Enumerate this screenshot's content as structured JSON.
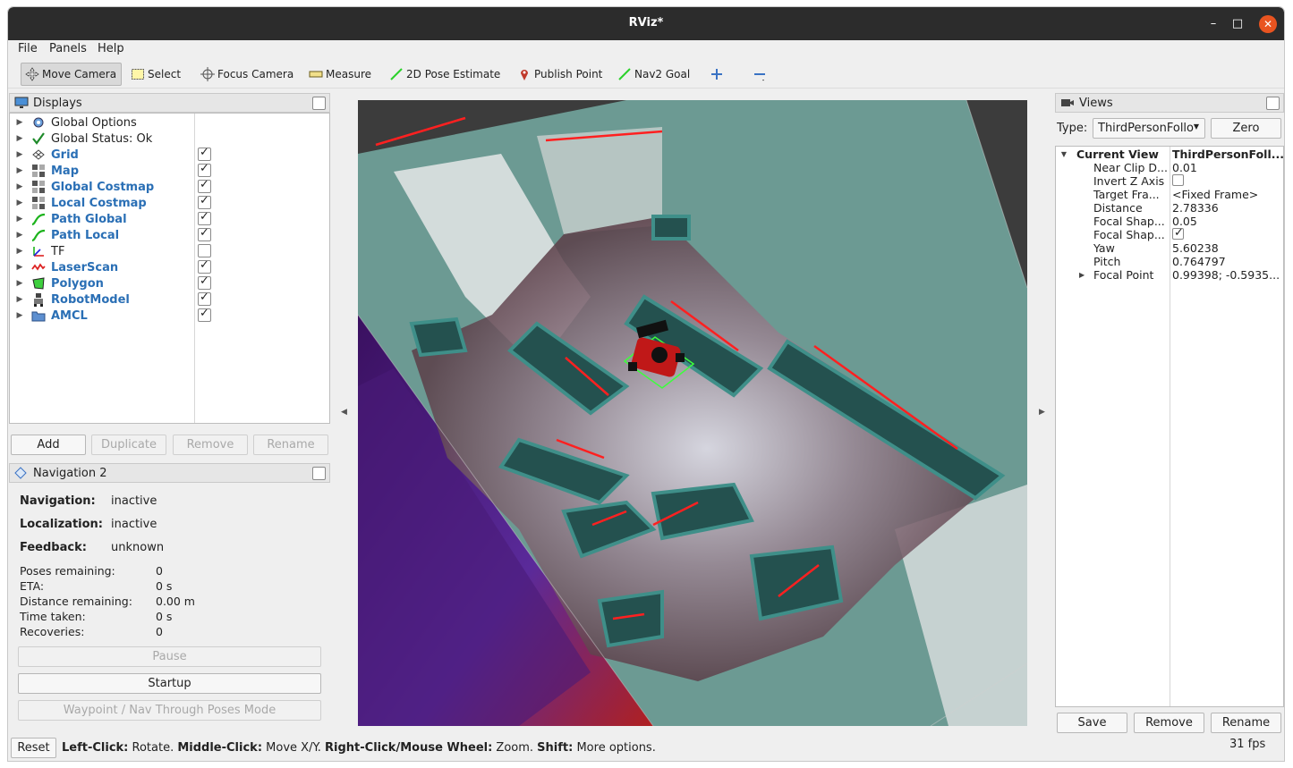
{
  "window": {
    "title": "RViz*"
  },
  "menu": [
    "File",
    "Panels",
    "Help"
  ],
  "toolbar": {
    "tools": [
      {
        "label": "Move Camera",
        "icon": "move-camera-icon",
        "active": true
      },
      {
        "label": "Select",
        "icon": "select-icon"
      },
      {
        "label": "Focus Camera",
        "icon": "focus-camera-icon"
      },
      {
        "label": "Measure",
        "icon": "measure-icon"
      },
      {
        "label": "2D Pose Estimate",
        "icon": "pose-estimate-icon"
      },
      {
        "label": "Publish Point",
        "icon": "publish-point-icon"
      },
      {
        "label": "Nav2 Goal",
        "icon": "nav2-goal-icon"
      }
    ]
  },
  "displays": {
    "title": "Displays",
    "items": [
      {
        "label": "Global Options",
        "icon": "gear-icon",
        "bold": false,
        "checkbox": null
      },
      {
        "label": "Global Status: Ok",
        "icon": "check-icon",
        "bold": false,
        "checkbox": null
      },
      {
        "label": "Grid",
        "icon": "grid-icon",
        "bold": true,
        "checkbox": true
      },
      {
        "label": "Map",
        "icon": "map-icon",
        "bold": true,
        "checkbox": true
      },
      {
        "label": "Global Costmap",
        "icon": "map-icon",
        "bold": true,
        "checkbox": true
      },
      {
        "label": "Local Costmap",
        "icon": "map-icon",
        "bold": true,
        "checkbox": true
      },
      {
        "label": "Path Global",
        "icon": "path-icon",
        "bold": true,
        "checkbox": true
      },
      {
        "label": "Path Local",
        "icon": "path-icon",
        "bold": true,
        "checkbox": true
      },
      {
        "label": "TF",
        "icon": "tf-icon",
        "bold": false,
        "checkbox": false
      },
      {
        "label": "LaserScan",
        "icon": "laserscan-icon",
        "bold": true,
        "checkbox": true
      },
      {
        "label": "Polygon",
        "icon": "polygon-icon",
        "bold": true,
        "checkbox": true
      },
      {
        "label": "RobotModel",
        "icon": "robot-model-icon",
        "bold": true,
        "checkbox": true
      },
      {
        "label": "AMCL",
        "icon": "folder-icon",
        "bold": true,
        "checkbox": true
      }
    ],
    "buttons": {
      "add": "Add",
      "duplicate": "Duplicate",
      "remove": "Remove",
      "rename": "Rename"
    }
  },
  "navigation": {
    "title": "Navigation 2",
    "navigation_label": "Navigation:",
    "navigation_value": "inactive",
    "localization_label": "Localization:",
    "localization_value": "inactive",
    "feedback_label": "Feedback:",
    "feedback_value": "unknown",
    "poses_label": "Poses remaining:",
    "poses_value": "0",
    "eta_label": "ETA:",
    "eta_value": "0 s",
    "distance_label": "Distance remaining:",
    "distance_value": "0.00 m",
    "time_label": "Time taken:",
    "time_value": "0 s",
    "recoveries_label": "Recoveries:",
    "recoveries_value": "0",
    "pause_button": "Pause",
    "startup_button": "Startup",
    "waypoint_button": "Waypoint / Nav Through Poses Mode"
  },
  "views": {
    "title": "Views",
    "type_label": "Type:",
    "type_value": "ThirdPersonFollo",
    "zero_button": "Zero",
    "current_view_label": "Current View",
    "current_view_value": "ThirdPersonFoll...",
    "properties": [
      {
        "name": "Near Clip D...",
        "value": "0.01"
      },
      {
        "name": "Invert Z Axis",
        "value": "",
        "checkbox": false
      },
      {
        "name": "Target Fra...",
        "value": "<Fixed Frame>"
      },
      {
        "name": "Distance",
        "value": "2.78336"
      },
      {
        "name": "Focal Shap...",
        "value": "0.05"
      },
      {
        "name": "Focal Shap...",
        "value": "",
        "checkbox": true
      },
      {
        "name": "Yaw",
        "value": "5.60238"
      },
      {
        "name": "Pitch",
        "value": "0.764797"
      },
      {
        "name": "Focal Point",
        "value": "0.99398; -0.5935...",
        "expandable": true
      }
    ],
    "buttons": {
      "save": "Save",
      "remove": "Remove",
      "rename": "Rename"
    }
  },
  "status": {
    "reset_button": "Reset",
    "hint_left_click": "Left-Click:",
    "hint_left_click_text": " Rotate. ",
    "hint_middle_click": "Middle-Click:",
    "hint_middle_click_text": " Move X/Y. ",
    "hint_right_click": "Right-Click/Mouse Wheel:",
    "hint_right_click_text": " Zoom. ",
    "hint_shift": "Shift:",
    "hint_shift_text": " More options.",
    "fps": "31 fps"
  }
}
